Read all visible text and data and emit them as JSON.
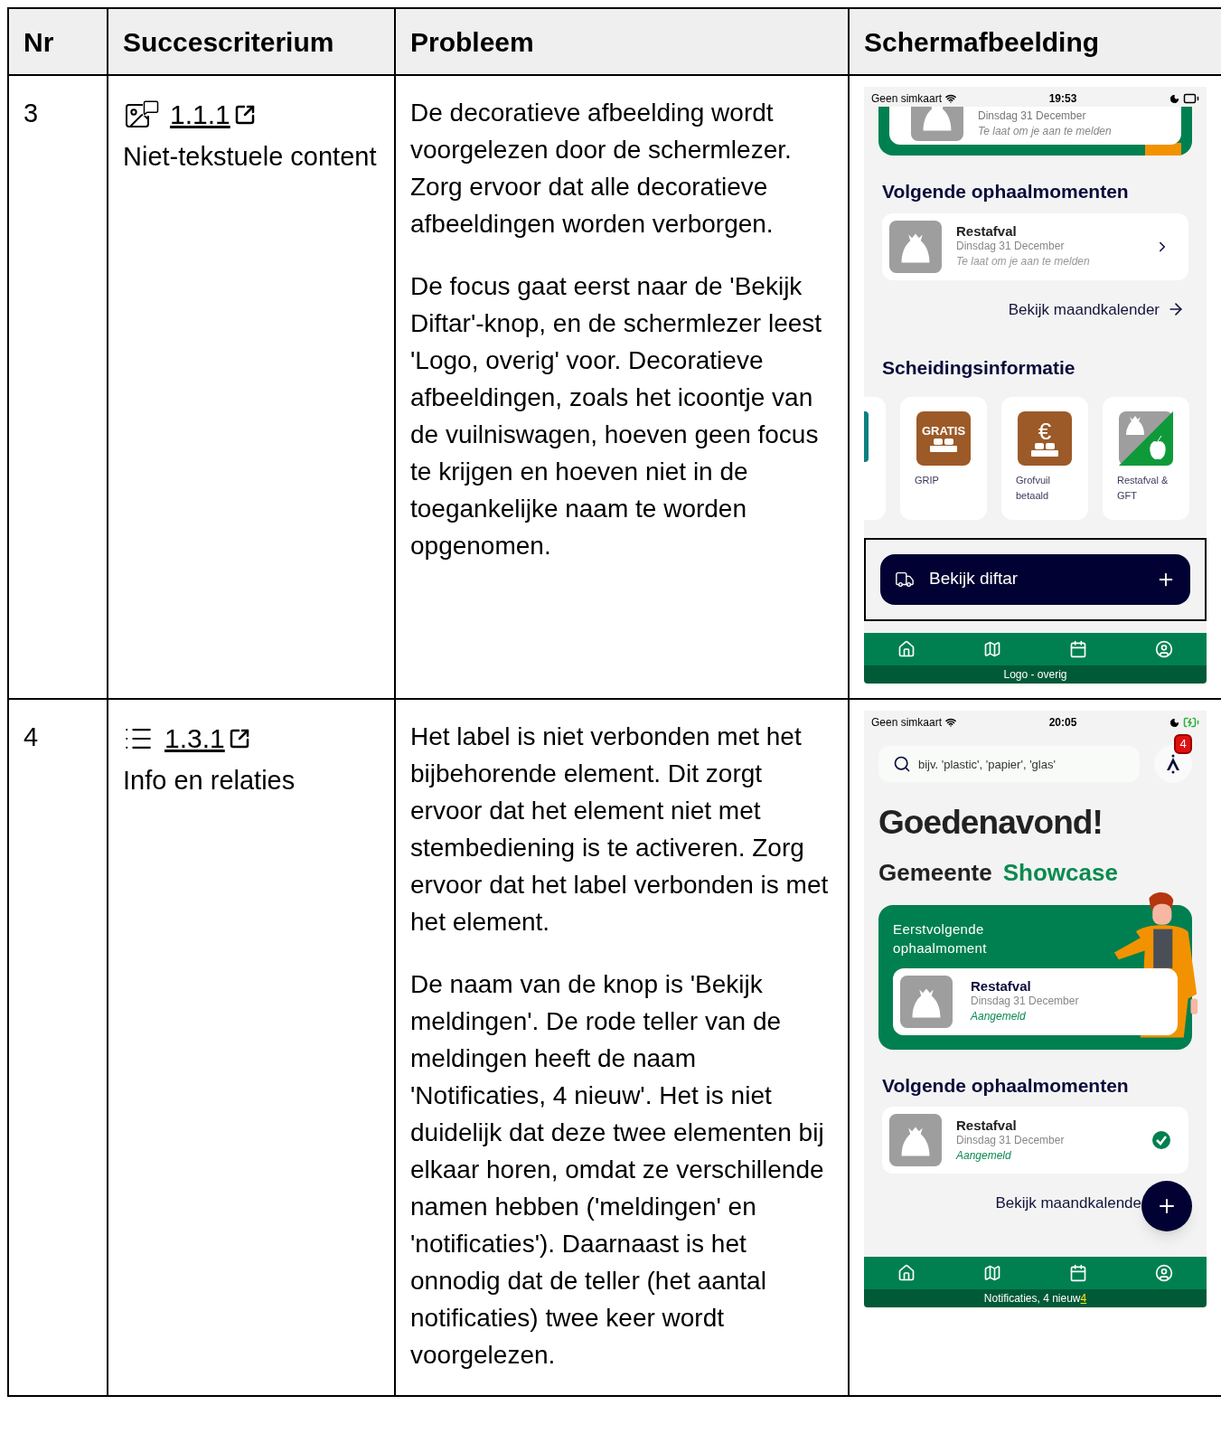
{
  "table": {
    "columns": [
      "Nr",
      "Succescriterium",
      "Probleem",
      "Schermafbeelding"
    ],
    "rows": [
      {
        "nr": "3",
        "criterion": {
          "kind": "image",
          "link": "1.1.1",
          "name": "Niet-tekstuele content"
        },
        "problem": [
          "De decoratieve afbeelding wordt voorgelezen door de schermlezer. Zorg ervoor dat alle decoratieve afbeeldingen worden verborgen.",
          "De focus gaat eerst naar de 'Bekijk Diftar'-knop, en de schermlezer leest 'Logo, overig' voor. Decoratieve afbeeldingen, zoals het icoontje van de vuilniswagen, hoeven geen focus te krijgen en hoeven niet in de toegankelijke naam te worden opgenomen."
        ],
        "screenshot": {
          "blocks": [
            {
              "kind": "status",
              "carrier": "Geen simkaart",
              "time": "19:53",
              "charging": false
            },
            {
              "kind": "cut_card",
              "date": "Dinsdag 31 December",
              "note": "Te laat om je aan te melden"
            },
            {
              "kind": "section_title",
              "text": "Volgende ophaalmomenten"
            },
            {
              "kind": "item",
              "title": "Restafval",
              "date": "Dinsdag 31 December",
              "note": "Te laat om je aan te melden",
              "registered": false
            },
            {
              "kind": "link",
              "label": "Bekijk maandkalender",
              "arrow": true,
              "fab": false
            },
            {
              "kind": "section_title",
              "text": "Scheidingsinformatie"
            },
            {
              "kind": "tiles",
              "tiles": [
                {
                  "kind": "text_sofa",
                  "glyph": "GRATIS",
                  "label": "GRIP"
                },
                {
                  "kind": "euro_sofa",
                  "glyph": "€",
                  "label": "Grofvuil betaald"
                },
                {
                  "kind": "split",
                  "label": "Restafval & GFT"
                }
              ]
            },
            {
              "kind": "fab",
              "label": "Bekijk diftar",
              "focused": true
            },
            {
              "kind": "nav",
              "caption": "Logo - overig"
            }
          ]
        }
      },
      {
        "nr": "4",
        "criterion": {
          "kind": "list",
          "link": "1.3.1",
          "name": "Info en relaties"
        },
        "problem": [
          "Het label is niet verbonden met het bijbehorende element. Dit zorgt ervoor dat het element niet met stembediening is te activeren. Zorg ervoor dat het label verbonden is met het element.",
          "De naam van de knop is 'Bekijk meldingen'. De rode teller van de meldingen heeft de naam 'Notificaties, 4 nieuw'. Het is niet duidelijk dat deze twee elementen bij elkaar horen, omdat ze verschillende namen hebben ('meldingen' en 'notificaties'). Daarnaast is het onnodig dat de teller (het aantal notificaties) twee keer wordt voorgelezen."
        ],
        "screenshot": {
          "blocks": [
            {
              "kind": "status",
              "carrier": "Geen simkaart",
              "time": "20:05",
              "charging": true
            },
            {
              "kind": "search",
              "placeholder": "bijv. 'plastic', 'papier', 'glas'",
              "badge": "4"
            },
            {
              "kind": "greeting",
              "text": "Goedenavond!"
            },
            {
              "kind": "municipality",
              "label": "Gemeente",
              "name": "Showcase"
            },
            {
              "kind": "hero",
              "label": "Eerstvolgende ophaalmoment",
              "title": "Restafval",
              "date": "Dinsdag 31 December",
              "note": "Aangemeld"
            },
            {
              "kind": "section_title",
              "text": "Volgende ophaalmomenten"
            },
            {
              "kind": "item",
              "title": "Restafval",
              "date": "Dinsdag 31 December",
              "note": "Aangemeld",
              "registered": true
            },
            {
              "kind": "link",
              "label": "Bekijk maandkalende",
              "arrow": false,
              "fab": true
            },
            {
              "kind": "nav",
              "caption": "Notificaties, 4 nieuw",
              "mark": "4"
            }
          ]
        }
      }
    ]
  }
}
